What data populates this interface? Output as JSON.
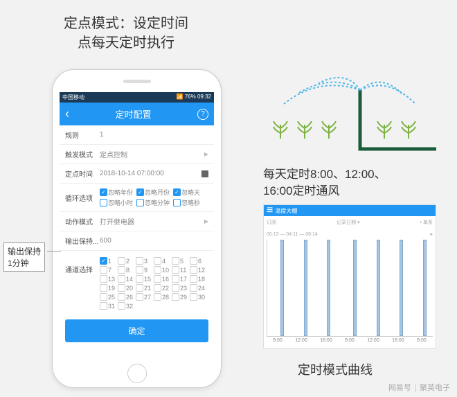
{
  "title_top": "定点模式：设定时间\n点每天定时执行",
  "status": {
    "left": "中国移动",
    "right": "09:32",
    "icons": "📶 76%"
  },
  "header": {
    "title": "定时配置"
  },
  "rows": {
    "rule": {
      "label": "规则",
      "value": "1"
    },
    "trigger": {
      "label": "触发模式",
      "value": "定点控制"
    },
    "time": {
      "label": "定点时间",
      "value": "2018-10-14 07:00:00"
    },
    "loop": {
      "label": "循环选项"
    },
    "action": {
      "label": "动作模式",
      "value": "打开继电器"
    },
    "output": {
      "label": "输出保持...",
      "value": "600"
    },
    "channel": {
      "label": "通道选择"
    }
  },
  "loop_options": [
    {
      "label": "忽略年份",
      "checked": true
    },
    {
      "label": "忽略月份",
      "checked": true
    },
    {
      "label": "忽略天",
      "checked": true
    },
    {
      "label": "忽略小时",
      "checked": false
    },
    {
      "label": "忽略分钟",
      "checked": false
    },
    {
      "label": "忽略秒",
      "checked": false
    }
  ],
  "channels": [
    1,
    2,
    3,
    4,
    5,
    6,
    7,
    8,
    9,
    10,
    11,
    12,
    13,
    14,
    15,
    16,
    17,
    18,
    19,
    20,
    21,
    22,
    23,
    24,
    25,
    26,
    27,
    28,
    29,
    30,
    31,
    32
  ],
  "channels_checked": [
    1
  ],
  "confirm": "确定",
  "callout": "输出保持\n1分钟",
  "schedule_text": "每天定时8:00、12:00、\n16:00定时通风",
  "chart": {
    "title": "温度大棚",
    "caption": "定时模式曲线"
  },
  "chart_data": {
    "type": "bar",
    "x_labels": [
      "8:00",
      "12:00",
      "16:00",
      "8:00",
      "12:00",
      "16:00",
      "8:00"
    ],
    "values": [
      100,
      100,
      100,
      100,
      100,
      100,
      100
    ],
    "positions_pct": [
      8,
      22,
      36,
      52,
      66,
      80,
      94
    ]
  },
  "footer": {
    "brand": "网易号",
    "author": "聚英电子"
  }
}
